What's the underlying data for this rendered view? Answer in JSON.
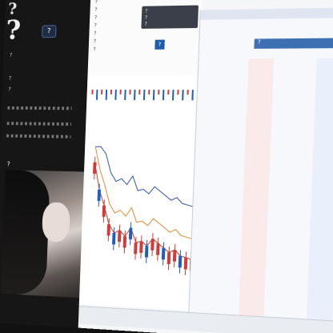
{
  "stream": {
    "title": "?",
    "big": "?",
    "badge": "?",
    "lines": [
      "?",
      "?",
      "?"
    ],
    "caption": "?"
  },
  "topinfo": {
    "lines": [
      "?",
      "?",
      "?",
      "?",
      "?",
      "?",
      "?"
    ]
  },
  "popup": {
    "line1": "?",
    "line2": "?",
    "line3": "?"
  },
  "blue_badge": "?",
  "orders": {
    "highlight": "?"
  },
  "colors": {
    "up": "#d33a3a",
    "down": "#1e5fbf",
    "ma_blue": "#2c4fa8",
    "ma_orange": "#e0892a",
    "ma_red": "#c0392b",
    "bg_panel": "#161616"
  },
  "chart_data": {
    "type": "candlestick",
    "series": [
      {
        "values": [
          85,
          66,
          55,
          42,
          36,
          38,
          34,
          40,
          30,
          31,
          28,
          33,
          30,
          27,
          24,
          26,
          22,
          21,
          20,
          24
        ]
      }
    ],
    "lines": [
      "ma_blue",
      "ma_orange",
      "ma_red"
    ]
  }
}
